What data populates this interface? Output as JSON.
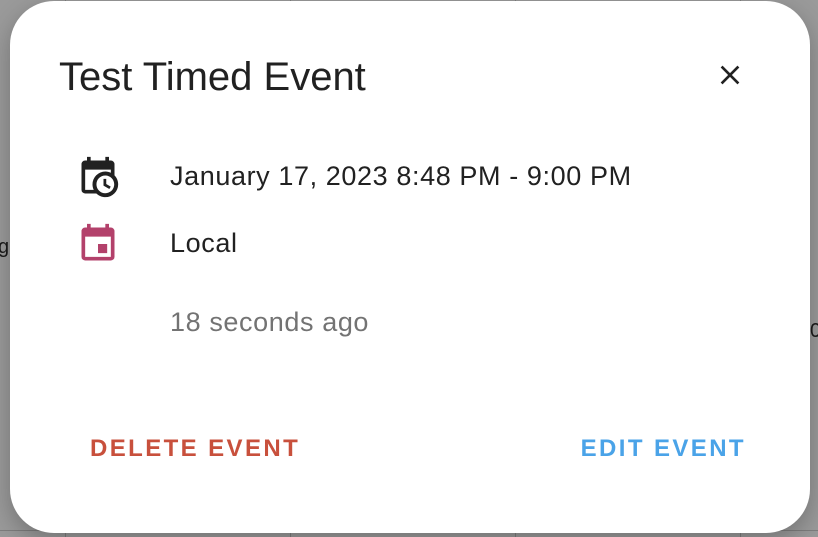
{
  "dialog": {
    "title": "Test Timed Event",
    "date_range": "January 17, 2023 8:48 PM - 9:00 PM",
    "calendar_name": "Local",
    "relative_time": "18 seconds ago",
    "delete_label": "DELETE EVENT",
    "edit_label": "EDIT EVENT"
  },
  "icons": {
    "close": "close-icon",
    "date": "calendar-clock-icon",
    "calendar": "calendar-icon"
  },
  "colors": {
    "calendar_accent": "#b3416b",
    "delete": "#c8503c",
    "edit": "#4aa3e8",
    "text_primary": "#212121",
    "text_secondary": "#737373"
  }
}
